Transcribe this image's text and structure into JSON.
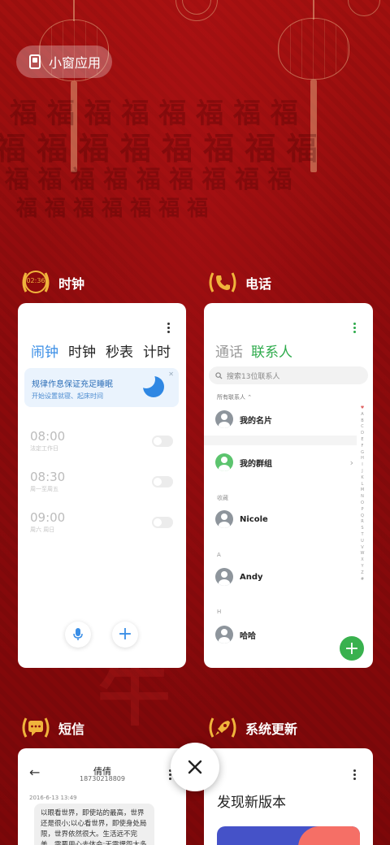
{
  "floating": {
    "label": "小窗应用",
    "icon": "small-window-icon"
  },
  "apps": [
    {
      "name": "时钟",
      "badge_text": "02:36",
      "icon": "clock-icon",
      "tabs": [
        "闹钟",
        "时钟",
        "秒表",
        "计时"
      ],
      "banner_title": "规律作息保证充足睡眠",
      "banner_sub": "开始设置就寝、起床时间",
      "alarms": [
        {
          "time": "08:00",
          "repeat": "法定工作日"
        },
        {
          "time": "08:30",
          "repeat": "周一至周五"
        },
        {
          "time": "09:00",
          "repeat": "周六 周日"
        }
      ]
    },
    {
      "name": "电话",
      "icon": "phone-icon",
      "tabs": [
        "通话",
        "联系人"
      ],
      "search_placeholder": "搜索13位联系人",
      "filter": "所有联系人",
      "contacts": [
        {
          "name": "我的名片"
        },
        {
          "name": "我的群组"
        },
        {
          "section": "收藏",
          "name": "Nicole"
        },
        {
          "section": "A",
          "name": "Andy"
        },
        {
          "section": "H",
          "name": "哈哈"
        }
      ],
      "alpha_index": [
        "♥",
        "A",
        "B",
        "C",
        "D",
        "E",
        "F",
        "G",
        "H",
        "I",
        "J",
        "K",
        "L",
        "M",
        "N",
        "O",
        "P",
        "Q",
        "R",
        "S",
        "T",
        "U",
        "V",
        "W",
        "X",
        "Y",
        "Z",
        "#"
      ]
    },
    {
      "name": "短信",
      "icon": "message-icon",
      "contact_name": "倩倩",
      "contact_number": "18730218809",
      "timestamp": "2016-6-13 13:49",
      "message": "以眼看世界，即使站的最高，世界还是很小;以心看世界，即使身处局限，世界依然很大。生活远不完美，需要用心去体会;无需埋怨太多"
    },
    {
      "name": "系统更新",
      "icon": "rocket-icon",
      "heading": "发现新版本"
    }
  ],
  "colors": {
    "accent_blue": "#3a8ee6",
    "accent_green": "#2eab4c",
    "gold": "#f0b43c"
  }
}
